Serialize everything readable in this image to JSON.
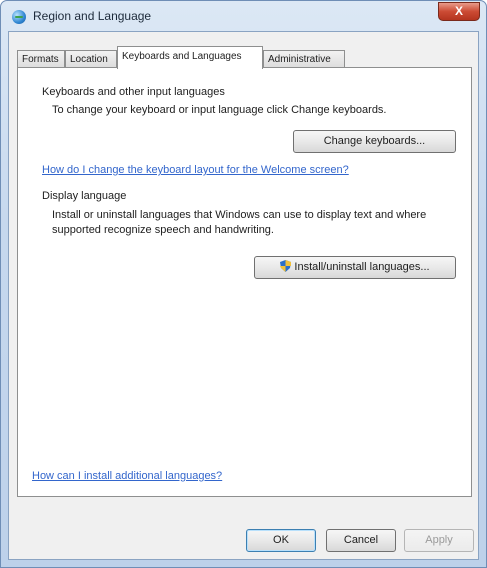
{
  "window": {
    "title": "Region and Language",
    "close_label": "X"
  },
  "tabs": [
    {
      "label": "Formats"
    },
    {
      "label": "Location"
    },
    {
      "label": "Keyboards and Languages"
    },
    {
      "label": "Administrative"
    }
  ],
  "keyboards": {
    "heading": "Keyboards and other input languages",
    "description": "To change your keyboard or input language click Change keyboards.",
    "change_button": "Change keyboards...",
    "welcome_link": "How do I change the keyboard layout for the Welcome screen?"
  },
  "display": {
    "heading": "Display language",
    "description": "Install or uninstall languages that Windows can use to display text and where supported recognize speech and handwriting.",
    "install_button": "Install/uninstall languages..."
  },
  "footer": {
    "help_link": "How can I install additional languages?",
    "ok": "OK",
    "cancel": "Cancel",
    "apply": "Apply"
  }
}
